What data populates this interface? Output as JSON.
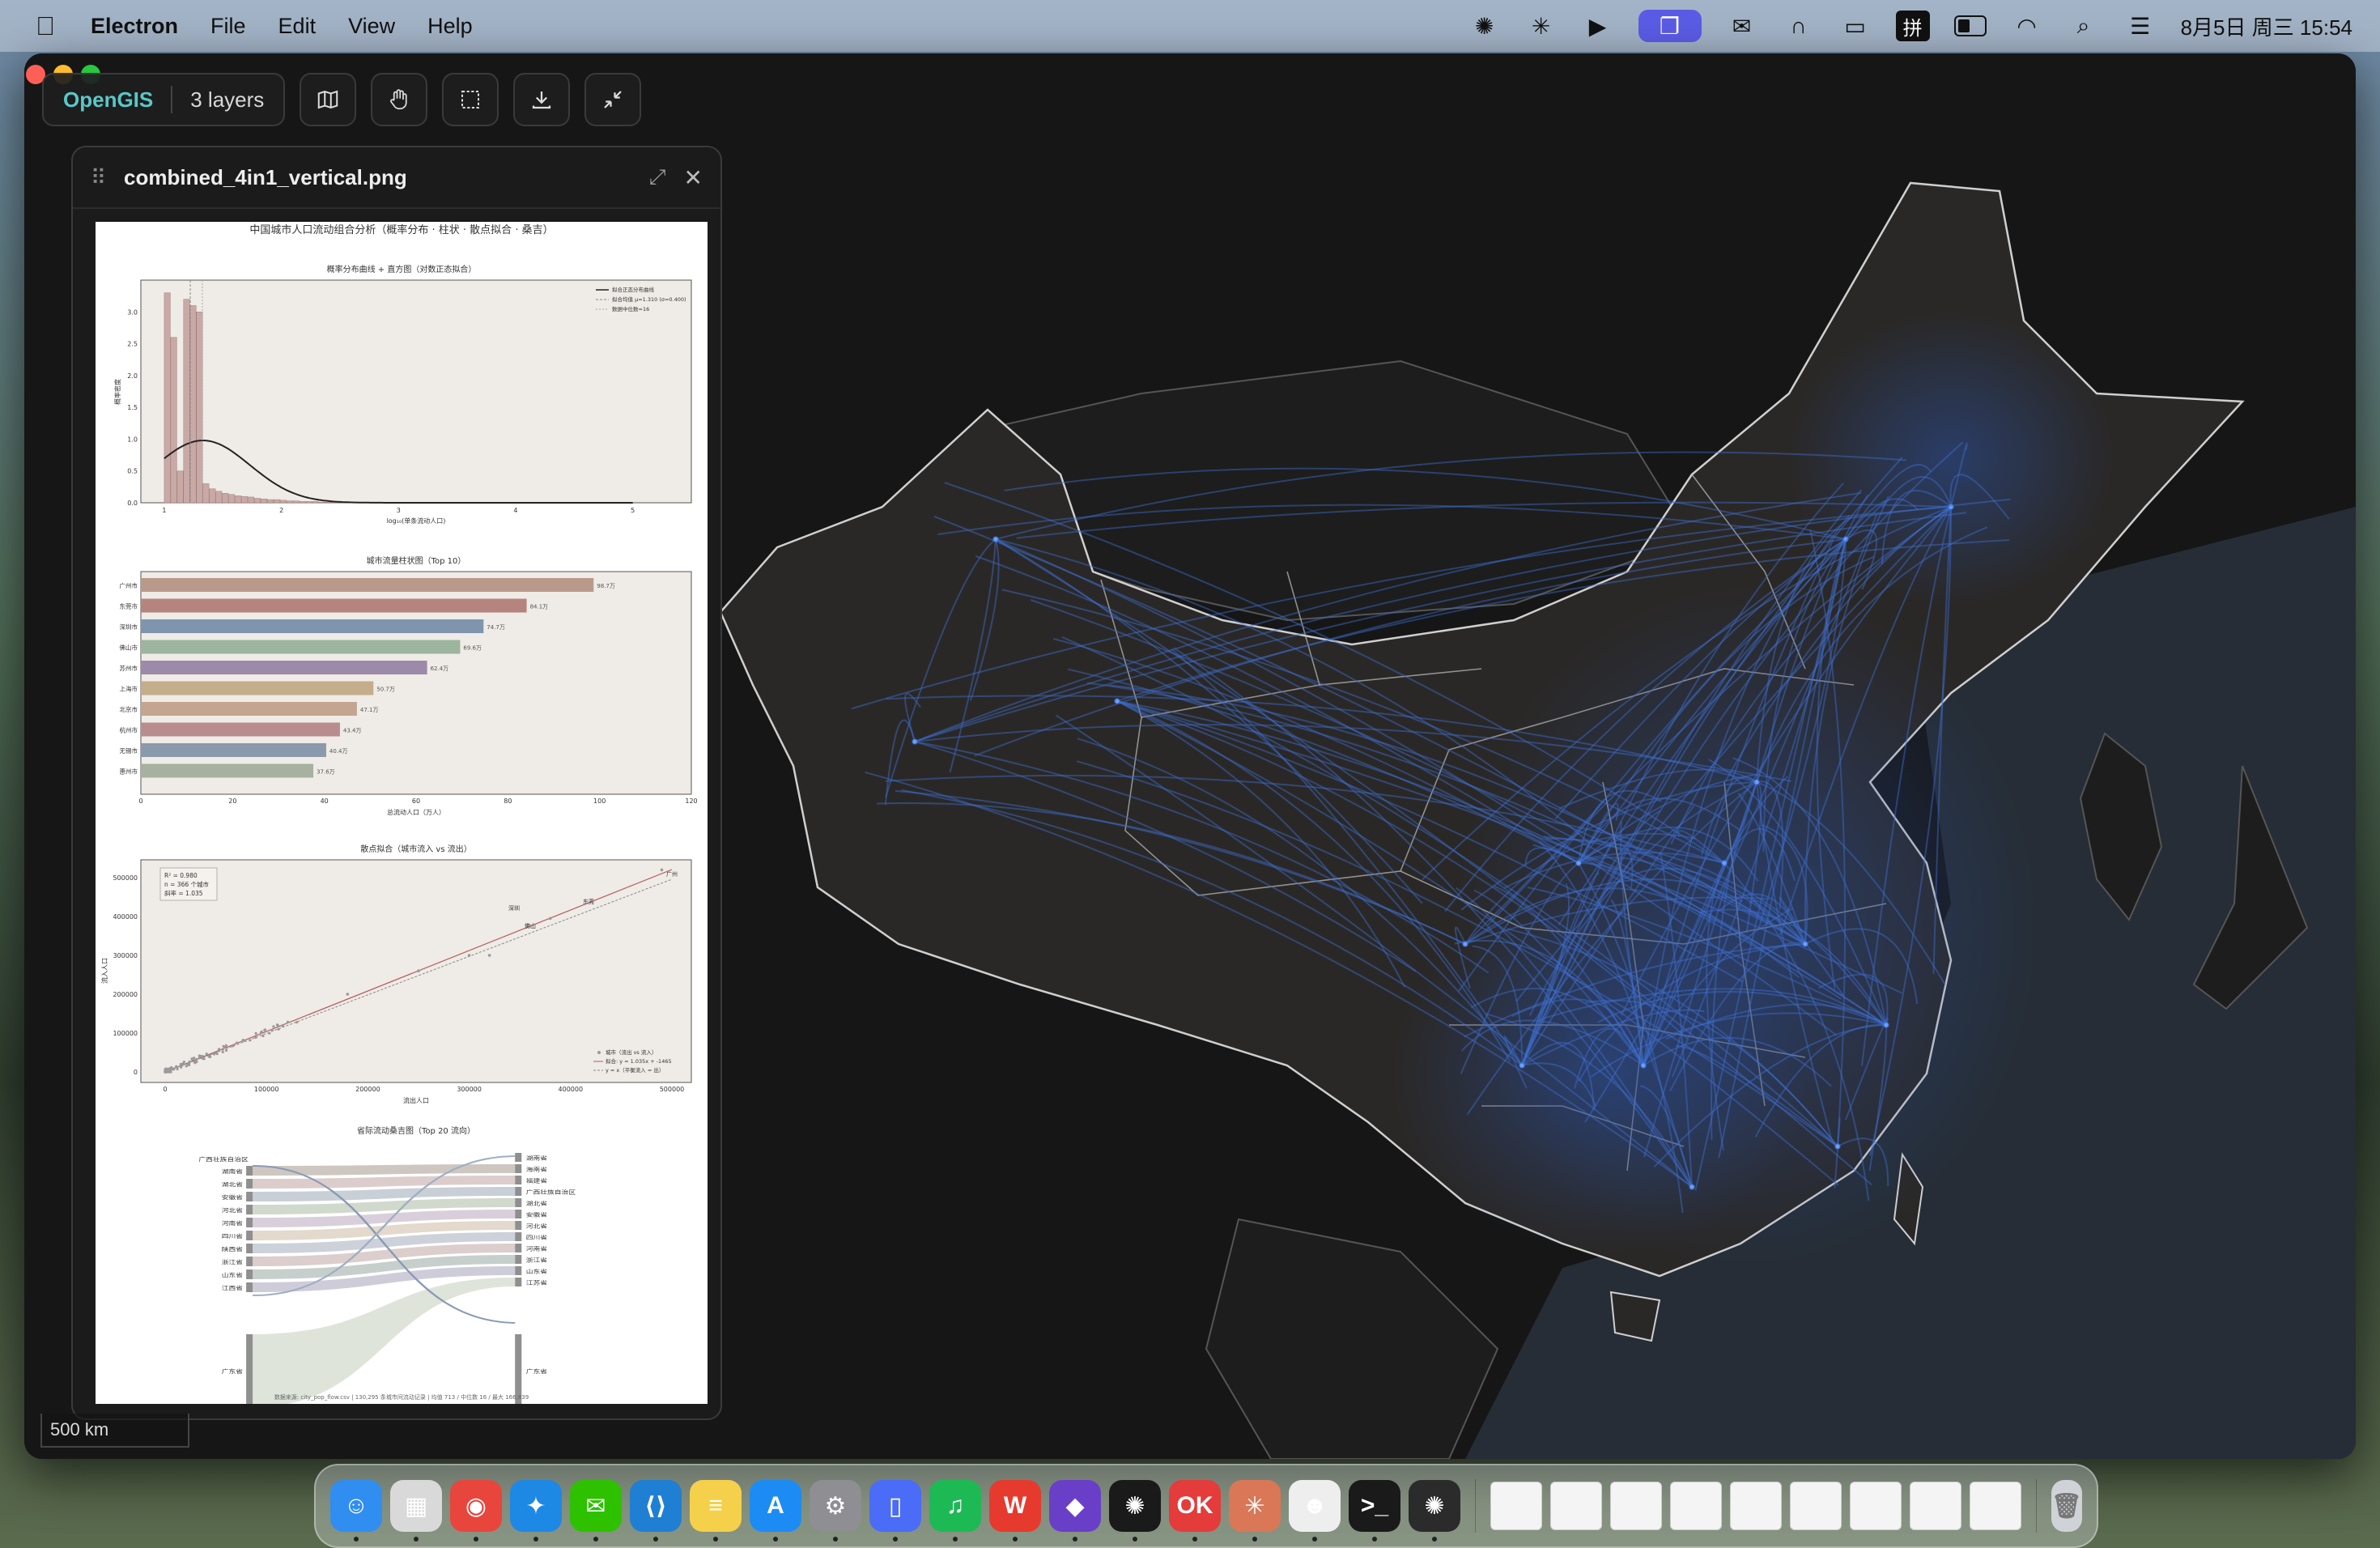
{
  "menubar": {
    "app_name": "Electron",
    "menus": [
      "File",
      "Edit",
      "View",
      "Help"
    ],
    "clock": "8月5日 周三  15:54",
    "pinyin_label": "拼"
  },
  "toolbar": {
    "brand": "OpenGIS",
    "layers": "3 layers"
  },
  "panel": {
    "filename": "combined_4in1_vertical.png",
    "image": {
      "main_title": "中国城市人口流动组合分析（概率分布 · 柱状 · 散点拟合 · 桑吉）",
      "hist": {
        "title": "概率分布曲线 + 直方图（对数正态拟合）",
        "xlabel": "log₁₀(单条流动人口)",
        "ylabel": "概率密度",
        "xticks": [
          "1",
          "2",
          "3",
          "4",
          "5"
        ],
        "yticks": [
          "0.0",
          "0.5",
          "1.0",
          "1.5",
          "2.0",
          "2.5",
          "3.0"
        ],
        "legend": [
          "拟合正态分布曲线",
          "拟合均值 μ=1.310 (σ=0.400)",
          "数据中位数=16"
        ]
      },
      "bar": {
        "title": "城市流量柱状图（Top 10）",
        "xlabel": "总流动人口（万人）",
        "xticks": [
          "0",
          "20",
          "40",
          "60",
          "80",
          "100",
          "120"
        ],
        "cities": [
          "广州市",
          "东莞市",
          "深圳市",
          "佛山市",
          "苏州市",
          "上海市",
          "北京市",
          "杭州市",
          "无锡市",
          "惠州市"
        ],
        "value_labels": [
          "98.7万",
          "84.1万",
          "74.7万",
          "69.6万",
          "62.4万",
          "50.7万",
          "47.1万",
          "43.4万",
          "40.4万",
          "37.6万"
        ],
        "values": [
          98.7,
          84.1,
          74.7,
          69.6,
          62.4,
          50.7,
          47.1,
          43.4,
          40.4,
          37.6
        ],
        "colors": [
          "#b99a8a",
          "#b6847e",
          "#7f95ad",
          "#9db49e",
          "#9c8aa8",
          "#c4ad8a",
          "#c4a58f",
          "#b98d8d",
          "#8a99ab",
          "#a6b19f"
        ]
      },
      "scatter": {
        "title": "散点拟合（城市流入 vs 流出）",
        "xlabel": "流出人口",
        "ylabel": "流入人口",
        "xticks": [
          "0",
          "100000",
          "200000",
          "300000",
          "400000",
          "500000"
        ],
        "yticks": [
          "0",
          "100000",
          "200000",
          "300000",
          "400000",
          "500000"
        ],
        "stats": [
          "R² = 0.980",
          "n = 366 个城市",
          "斜率 = 1.035"
        ],
        "labels": [
          "深圳",
          "东莞",
          "广州",
          "佛山"
        ],
        "legend": [
          "城市（流出 vs 流入）",
          "拟合: y = 1.035x + -1465",
          "y = x（平衡流入 = 出）"
        ]
      },
      "sankey": {
        "title": "省际流动桑吉图（Top 20 流向）",
        "left_top": "广西壮族自治区",
        "left_nodes": [
          "湖南省",
          "湖北省",
          "安徽省",
          "河北省",
          "河南省",
          "四川省",
          "陕西省",
          "浙江省",
          "山东省",
          "江西省",
          "广东省"
        ],
        "right_nodes": [
          "湖南省",
          "海南省",
          "福建省",
          "广西壮族自治区",
          "湖北省",
          "安徽省",
          "河北省",
          "四川省",
          "河南省",
          "浙江省",
          "山东省",
          "江苏省",
          "广东省"
        ]
      },
      "footer": "数据来源: city_pop_flow.csv  |  130,295 条城市间流动记录  |  均值 713 / 中位数 16 / 最大 166,839"
    }
  },
  "scale_bar": "500 km",
  "dock": {
    "apps": [
      {
        "name": "finder-icon",
        "color": "#2f8ef0",
        "glyph": "☺"
      },
      {
        "name": "launchpad-icon",
        "color": "#d9d9d9",
        "glyph": "▦"
      },
      {
        "name": "chrome-icon",
        "color": "#e8453c",
        "glyph": "◉"
      },
      {
        "name": "safari-icon",
        "color": "#1e88e5",
        "glyph": "✦"
      },
      {
        "name": "wechat-icon",
        "color": "#2dc100",
        "glyph": "✉"
      },
      {
        "name": "vscode-icon",
        "color": "#1f7fd3",
        "glyph": "⟨⟩"
      },
      {
        "name": "notes-icon",
        "color": "#f5d04a",
        "glyph": "≡"
      },
      {
        "name": "app-store-icon",
        "color": "#1c8cf4",
        "glyph": "A"
      },
      {
        "name": "system-settings-icon",
        "color": "#8e8e93",
        "glyph": "⚙"
      },
      {
        "name": "phone-mirror-icon",
        "color": "#4a6cf7",
        "glyph": "▯"
      },
      {
        "name": "spotify-icon",
        "color": "#1db954",
        "glyph": "♫"
      },
      {
        "name": "wps-icon",
        "color": "#e63a2e",
        "glyph": "W"
      },
      {
        "name": "obsidian-icon",
        "color": "#6a3fc8",
        "glyph": "◆"
      },
      {
        "name": "chatgpt-icon",
        "color": "#1a1a1a",
        "glyph": "✺"
      },
      {
        "name": "ok-app-icon",
        "color": "#e43b3b",
        "glyph": "OK"
      },
      {
        "name": "claude-icon",
        "color": "#d97757",
        "glyph": "✳"
      },
      {
        "name": "mascot-app-icon",
        "color": "#eeeeee",
        "glyph": "☻"
      },
      {
        "name": "terminal-icon",
        "color": "#1a1a1a",
        "glyph": ">_"
      },
      {
        "name": "openai-icon",
        "color": "#2b2b2b",
        "glyph": "✺"
      }
    ],
    "window_count": 9
  }
}
